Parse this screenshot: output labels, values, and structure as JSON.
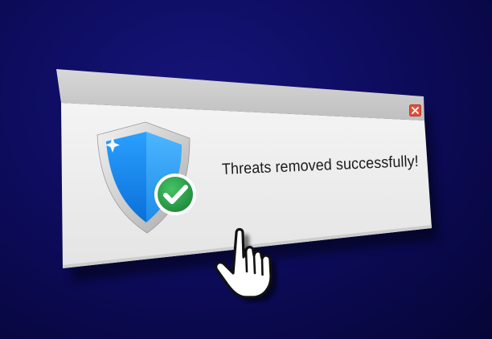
{
  "dialog": {
    "message": "Threats removed successfully!",
    "close_icon": "close-icon",
    "status_icon": "shield-check-icon"
  },
  "cursor": {
    "icon": "hand-pointer-icon"
  },
  "colors": {
    "background": "#0d0c5e",
    "titlebar": "#c9c9c9",
    "dialog_body": "#eeeeee",
    "shield_blue": "#1e8df0",
    "check_green": "#2fa84f",
    "close_red": "#e0503a"
  }
}
